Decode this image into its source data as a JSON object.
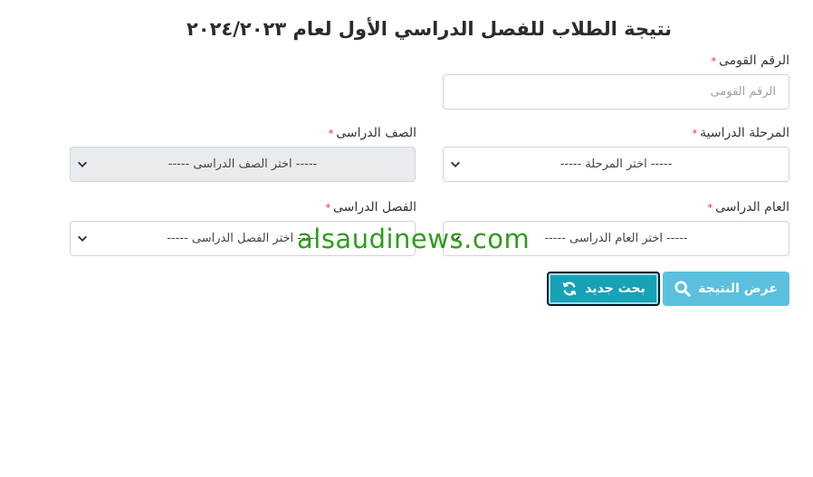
{
  "page_title": "نتيجة الطلاب للفصل الدراسي الأول لعام ٢٠٢٤/٢٠٢٣",
  "required_mark": "*",
  "fields": {
    "national_id": {
      "label": "الرقم القومى",
      "placeholder": "الرقم القومى"
    },
    "stage": {
      "label": "المرحلة الدراسية",
      "selected": "----- اختر المرحلة -----"
    },
    "grade": {
      "label": "الصف الدراسى",
      "selected": "----- اختر الصف الدراسى -----"
    },
    "year": {
      "label": "العام الدراسى",
      "selected": "----- اختر العام الدراسى -----"
    },
    "term": {
      "label": "الفصل الدراسى",
      "selected": "----- اختر الفصل الدراسى -----"
    }
  },
  "buttons": {
    "show_result": "عرض النتيجة",
    "new_search": "بحث جديد"
  },
  "watermark": "alsaudinews.com",
  "icons": {
    "show_result": "search-icon",
    "new_search": "refresh-icon",
    "select": "chevron-down-icon"
  },
  "colors": {
    "show_result_button": "#5bc0de",
    "new_search_button": "#17a2b8",
    "required": "#e02424",
    "watermark": "#2e9e1a"
  }
}
